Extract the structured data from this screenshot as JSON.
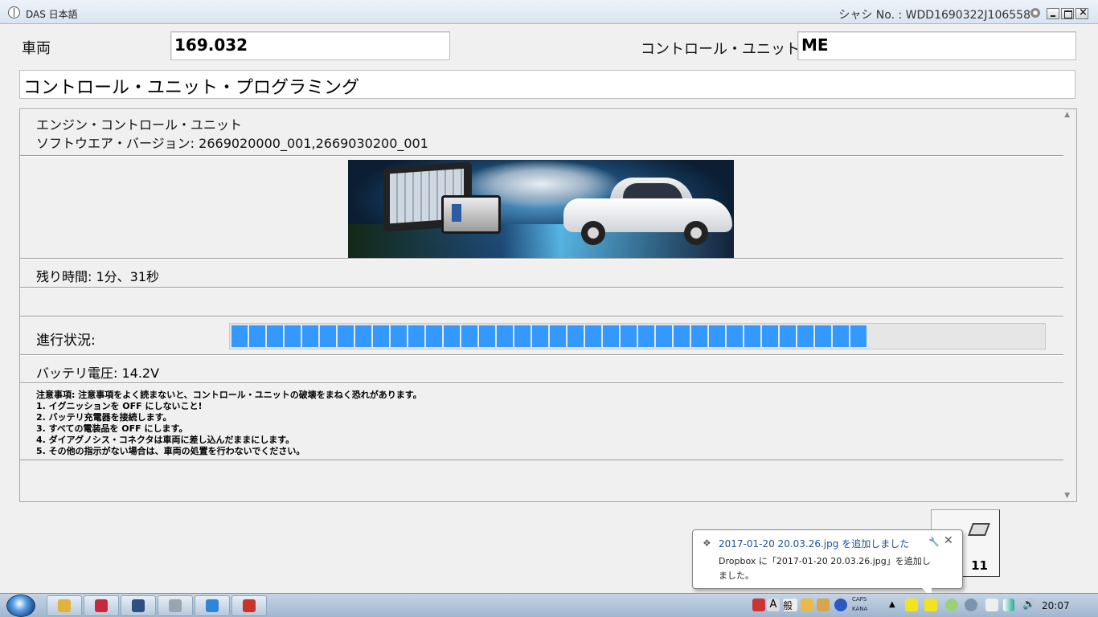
{
  "window": {
    "title": "DAS 日本語",
    "chassis": "シャシ No. : WDD1690322J106558"
  },
  "header": {
    "vehicle_label": "車両",
    "vehicle_value": "169.032",
    "control_unit_label": "コントロール・ユニット",
    "control_unit_value": "ME",
    "page_title": "コントロール・ユニット・プログラミング"
  },
  "panel": {
    "ecu_name": "エンジン・コントロール・ユニット",
    "software_version": "ソフトウエア・バージョン: 2669020000_001,2669030200_001",
    "remaining_time": "残り時間: 1分、31秒",
    "progress_label": "進行状況:",
    "progress": {
      "total_blocks": 46,
      "filled_blocks": 36,
      "color": "#3399ff"
    },
    "battery_voltage": "バッテリ電圧: 14.2V",
    "notes": [
      "注意事項:  注意事項をよく読まないと、コントロール・ユニットの破壊をまねく恐れがあります。",
      "1. イグニッションを OFF にしないこと!",
      "2. バッテリ充電器を接続します。",
      "3. すべての電装品を OFF にします。",
      "4. ダイアグノシス・コネクタは車両に差し込んだままにします。",
      "5. その他の指示がない場合は、車両の処置を行わないでください。"
    ]
  },
  "footer_button": {
    "key_label": "11",
    "icon": "printer-icon"
  },
  "notification": {
    "title": "2017-01-20 20.03.26.jpg を追加しました",
    "text": "Dropbox に「2017-01-20 20.03.26.jpg」を追加しました。",
    "icon": "dropbox-icon"
  },
  "taskbar": {
    "buttons": [
      {
        "name": "explorer",
        "color": "#e2b33b"
      },
      {
        "name": "app-red",
        "color": "#c8283b"
      },
      {
        "name": "app-x",
        "color": "#2e4f7f"
      },
      {
        "name": "das-app",
        "color": "#9aa4ae"
      },
      {
        "name": "internet-explorer",
        "color": "#2f86d8"
      },
      {
        "name": "app-mailbox",
        "color": "#c9332b"
      }
    ],
    "tray": {
      "ime_a": "A",
      "ime_mode": "般",
      "caps": "CAPS",
      "kana": "KANA"
    },
    "clock": "20:07"
  }
}
